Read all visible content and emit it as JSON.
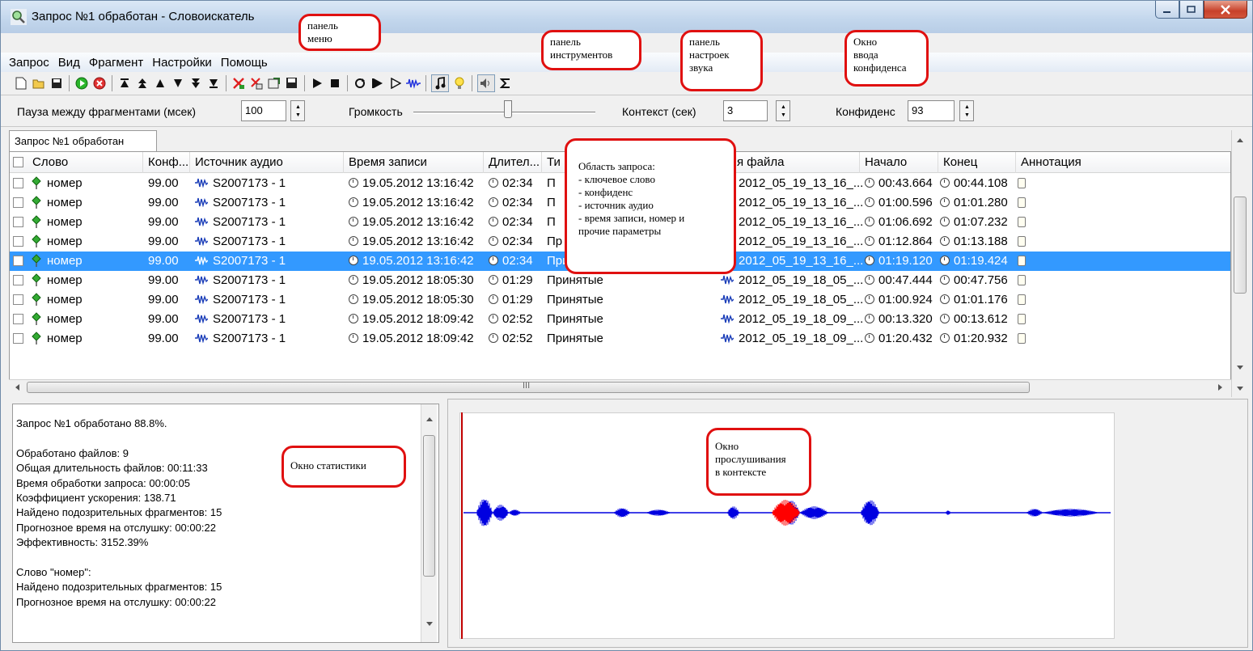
{
  "window": {
    "title": "Запрос №1 обработан - Словоискатель"
  },
  "menu": [
    "Запрос",
    "Вид",
    "Фрагмент",
    "Настройки",
    "Помощь"
  ],
  "sound_settings": {
    "pause_label": "Пауза между фрагментами (мсек)",
    "pause_value": "100",
    "volume_label": "Громкость",
    "volume_level": 0.5,
    "context_label": "Контекст (сек)",
    "context_value": "3",
    "confidence_label": "Конфиденс",
    "confidence_value": "93"
  },
  "query_tab": "Запрос №1 обработан",
  "columns": [
    "Слово",
    "Конф...",
    "Источник аудио",
    "Время записи",
    "Длител...",
    "Ти",
    "я файла",
    "Начало",
    "Конец",
    "Аннотация"
  ],
  "rows": [
    {
      "word": "номер",
      "conf": "99.00",
      "source": "S2007173 - 1",
      "time": "19.05.2012 13:16:42",
      "dur": "02:34",
      "type": "П",
      "file": "2012_05_19_13_16_...",
      "start": "00:43.664",
      "end": "00:44.108",
      "selected": false
    },
    {
      "word": "номер",
      "conf": "99.00",
      "source": "S2007173 - 1",
      "time": "19.05.2012 13:16:42",
      "dur": "02:34",
      "type": "П",
      "file": "2012_05_19_13_16_...",
      "start": "01:00.596",
      "end": "01:01.280",
      "selected": false
    },
    {
      "word": "номер",
      "conf": "99.00",
      "source": "S2007173 - 1",
      "time": "19.05.2012 13:16:42",
      "dur": "02:34",
      "type": "П",
      "file": "2012_05_19_13_16_...",
      "start": "01:06.692",
      "end": "01:07.232",
      "selected": false
    },
    {
      "word": "номер",
      "conf": "99.00",
      "source": "S2007173 - 1",
      "time": "19.05.2012 13:16:42",
      "dur": "02:34",
      "type": "Пр",
      "file": "2012_05_19_13_16_...",
      "start": "01:12.864",
      "end": "01:13.188",
      "selected": false
    },
    {
      "word": "номер",
      "conf": "99.00",
      "source": "S2007173 - 1",
      "time": "19.05.2012 13:16:42",
      "dur": "02:34",
      "type": "Приня",
      "file": "2012_05_19_13_16_...",
      "start": "01:19.120",
      "end": "01:19.424",
      "selected": true
    },
    {
      "word": "номер",
      "conf": "99.00",
      "source": "S2007173 - 1",
      "time": "19.05.2012 18:05:30",
      "dur": "01:29",
      "type": "Принятые",
      "file": "2012_05_19_18_05_...",
      "start": "00:47.444",
      "end": "00:47.756",
      "selected": false
    },
    {
      "word": "номер",
      "conf": "99.00",
      "source": "S2007173 - 1",
      "time": "19.05.2012 18:05:30",
      "dur": "01:29",
      "type": "Принятые",
      "file": "2012_05_19_18_05_...",
      "start": "01:00.924",
      "end": "01:01.176",
      "selected": false
    },
    {
      "word": "номер",
      "conf": "99.00",
      "source": "S2007173 - 1",
      "time": "19.05.2012 18:09:42",
      "dur": "02:52",
      "type": "Принятые",
      "file": "2012_05_19_18_09_...",
      "start": "00:13.320",
      "end": "00:13.612",
      "selected": false
    },
    {
      "word": "номер",
      "conf": "99.00",
      "source": "S2007173 - 1",
      "time": "19.05.2012 18:09:42",
      "dur": "02:52",
      "type": "Принятые",
      "file": "2012_05_19_18_09_...",
      "start": "01:20.432",
      "end": "01:20.932",
      "selected": false
    }
  ],
  "hscroll_glyph": "III",
  "stats": {
    "lines": [
      "Запрос №1 обработано 88.8%.",
      "",
      "Обработано файлов: 9",
      "Общая длительность файлов: 00:11:33",
      "Время обработки запроса: 00:00:05",
      "Коэффициент ускорения: 138.71",
      "Найдено подозрительных фрагментов: 15",
      "Прогнозное время на отслушку: 00:00:22",
      "Эффективность: 3152.39%",
      "",
      "Слово \"номер\":",
      "Найдено подозрительных фрагментов: 15",
      "Прогнозное время на отслушку: 00:00:22"
    ]
  },
  "callouts": {
    "menu": [
      "панель",
      "меню"
    ],
    "toolbar": [
      "панель",
      "инструментов"
    ],
    "sound": [
      "панель",
      "настроек",
      "звука"
    ],
    "confidence": [
      "Окно",
      "ввода",
      "конфиденса"
    ],
    "query_area": [
      "Область запроса:",
      "- ключевое слово",
      "- конфиденс",
      "- источник аудио",
      "- время записи, номер и",
      "прочие параметры"
    ],
    "stats": [
      "Окно статистики"
    ],
    "listen": [
      "Окно",
      "прослушивания",
      "в контексте"
    ]
  },
  "colors": {
    "selection": "#3399ff",
    "callout_border": "#e01010",
    "waveform": "#0000e0",
    "waveform_highlight": "#ff0000"
  }
}
